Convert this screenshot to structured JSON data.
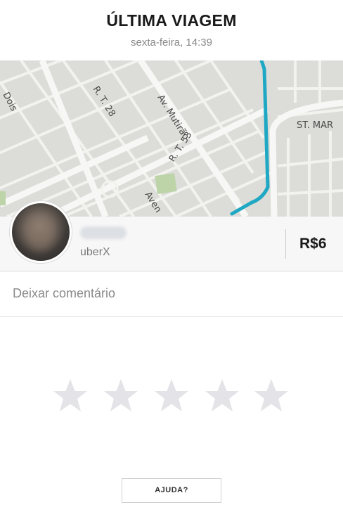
{
  "header": {
    "title": "ÚLTIMA VIAGEM",
    "subtitle": "sexta-feira, 14:39"
  },
  "map": {
    "labels": {
      "dois": "Dois",
      "rt28": "R. T. 28",
      "mutirao": "Av. Mutirão",
      "rt53": "R. T. 53",
      "st_mar": "ST. MAR",
      "avenida": "Aven"
    },
    "route_color": "#1fa8c4"
  },
  "driver": {
    "vehicle": "uberX",
    "fare": "R$6"
  },
  "comment": {
    "placeholder": "Deixar comentário"
  },
  "rating": {
    "stars": 5,
    "selected": 0,
    "star_color": "#e3e3e8"
  },
  "help": {
    "label": "AJUDA?"
  }
}
